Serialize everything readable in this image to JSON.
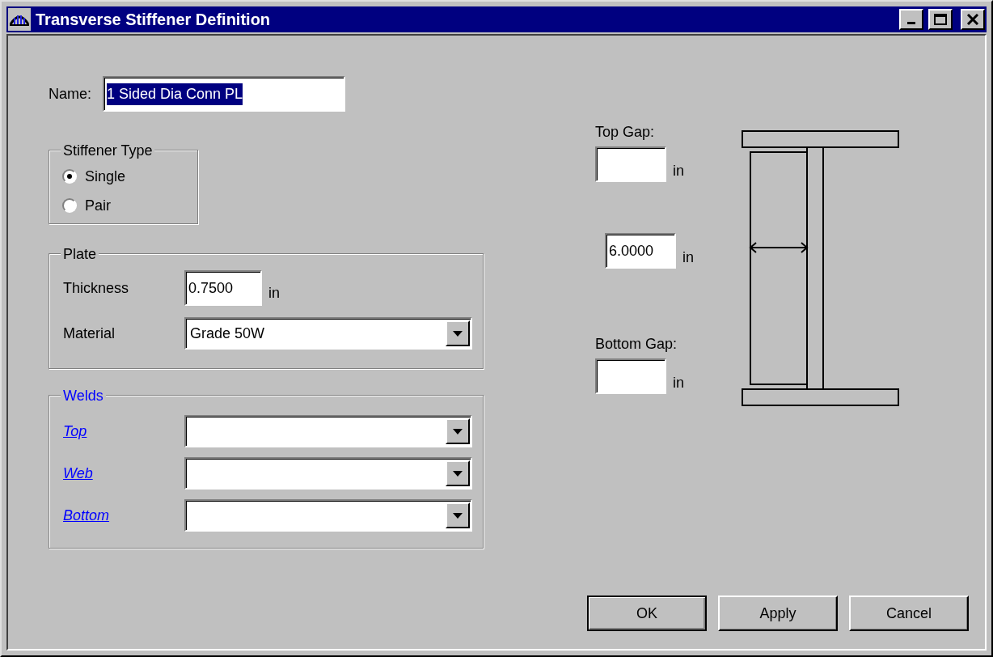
{
  "window": {
    "title": "Transverse Stiffener Definition"
  },
  "name_field": {
    "label": "Name:",
    "value": "1 Sided Dia Conn PL",
    "text_selected": true
  },
  "stiffener_type": {
    "title": "Stiffener Type",
    "options": [
      {
        "label": "Single",
        "selected": true
      },
      {
        "label": "Pair",
        "selected": false
      }
    ]
  },
  "plate": {
    "title": "Plate",
    "thickness": {
      "label": "Thickness",
      "value": "0.7500",
      "unit": "in"
    },
    "material": {
      "label": "Material",
      "value": "Grade 50W"
    }
  },
  "welds": {
    "title": "Welds",
    "rows": [
      {
        "label": "Top"
      },
      {
        "label": "Web"
      },
      {
        "label": "Bottom"
      }
    ]
  },
  "gaps": {
    "top": {
      "label": "Top Gap:",
      "unit": "in"
    },
    "width": {
      "value": "6.0000",
      "unit": "in"
    },
    "bottom": {
      "label": "Bottom Gap:",
      "unit": "in"
    }
  },
  "buttons": [
    {
      "label": "OK",
      "default": true
    },
    {
      "label": "Apply",
      "default": false
    },
    {
      "label": "Cancel",
      "default": false
    }
  ]
}
